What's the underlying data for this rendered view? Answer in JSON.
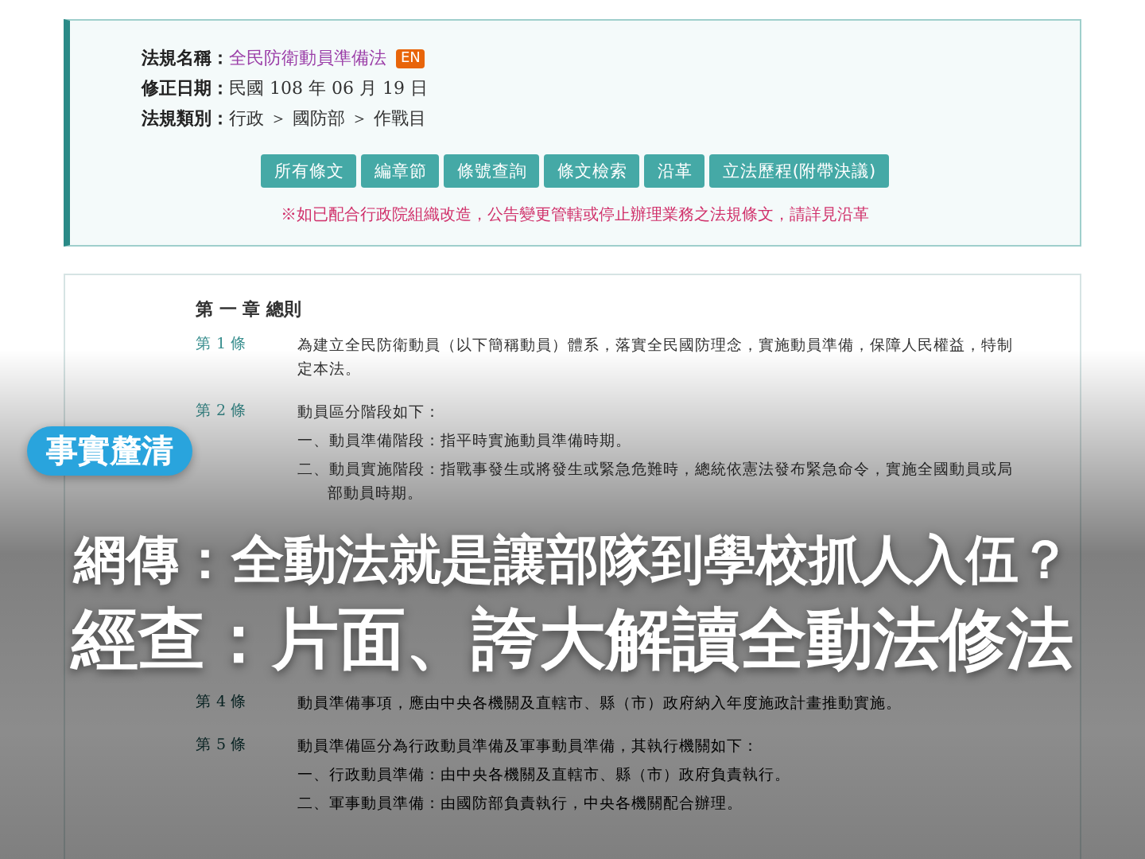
{
  "law_info": {
    "rows": [
      {
        "label": "法規名稱：",
        "value": "全民防衛動員準備法",
        "kind": "link",
        "badge": "EN"
      },
      {
        "label": "修正日期：",
        "value": "民國 108 年 06 月 19 日",
        "kind": "text"
      },
      {
        "label": "法規類別：",
        "value": "行政 ＞ 國防部 ＞ 作戰目",
        "kind": "text"
      }
    ],
    "buttons": [
      "所有條文",
      "編章節",
      "條號查詢",
      "條文檢索",
      "沿革",
      "立法歷程(附帶決議)"
    ],
    "notice": "※如已配合行政院組織改造，公告變更管轄或停止辦理業務之法規條文，請詳見沿革"
  },
  "chapter": "第 一 章 總則",
  "articles": [
    {
      "number": "第 1 條",
      "lines": [
        {
          "kind": "para",
          "text": "為建立全民防衛動員（以下簡稱動員）體系，落實全民國防理念，實施動員準備，保障人民權益，特制定本法。"
        }
      ]
    },
    {
      "number": "第 2 條",
      "lines": [
        {
          "kind": "para",
          "text": "動員區分階段如下："
        },
        {
          "kind": "item",
          "text": "一、動員準備階段：指平時實施動員準備時期。"
        },
        {
          "kind": "item",
          "text": "二、動員實施階段：指戰事發生或將發生或緊急危難時，總統依憲法發布緊急命令，實施全國動員或局部動員時期。"
        }
      ]
    },
    {
      "number": "第 4 條",
      "lines": [
        {
          "kind": "para",
          "text": "動員準備事項，應由中央各機關及直轄市、縣（市）政府納入年度施政計畫推動實施。"
        }
      ]
    },
    {
      "number": "第 5 條",
      "lines": [
        {
          "kind": "para",
          "text": "動員準備區分為行政動員準備及軍事動員準備，其執行機關如下："
        },
        {
          "kind": "item",
          "text": "一、行政動員準備：由中央各機關及直轄市、縣（市）政府負責執行。"
        },
        {
          "kind": "item",
          "text": "二、軍事動員準備：由國防部負責執行，中央各機關配合辦理。"
        }
      ]
    }
  ],
  "overlay": {
    "badge": "事實釐清",
    "headlines": [
      "網傳：全動法就是讓部隊到學校抓人入伍？",
      "經查：片面、誇大解讀全動法修法"
    ]
  }
}
